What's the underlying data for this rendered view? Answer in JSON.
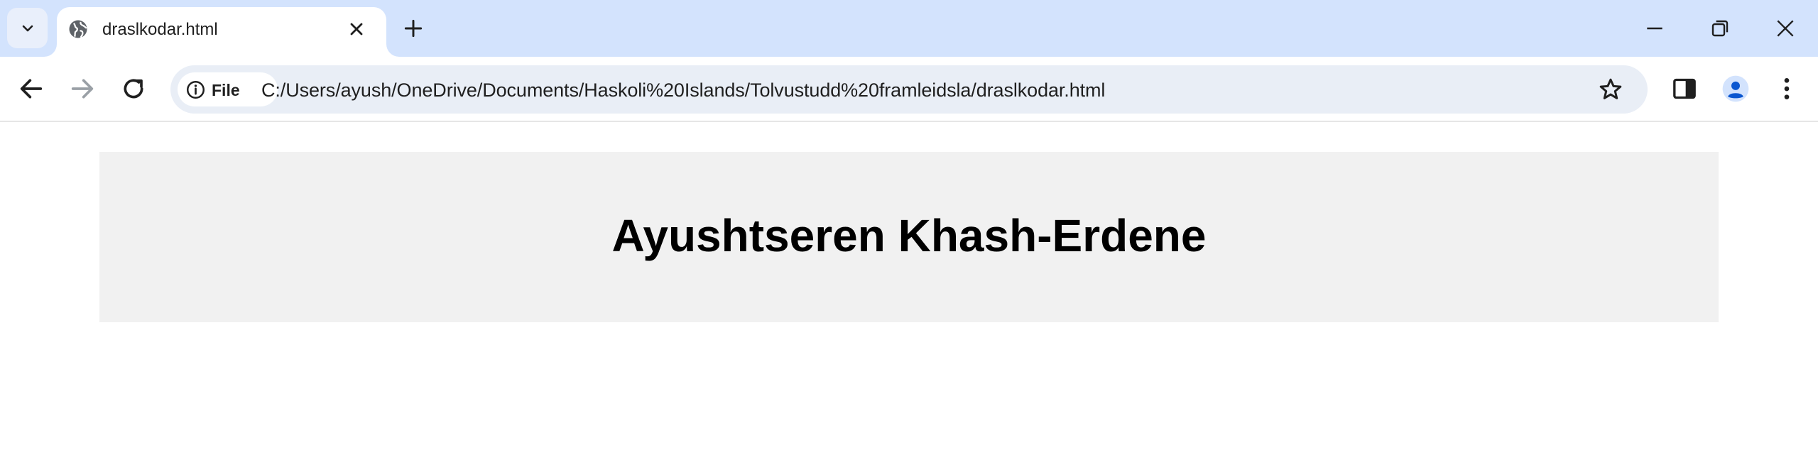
{
  "browser": {
    "tab": {
      "title": "draslkodar.html"
    },
    "address_bar": {
      "chip_label": "File",
      "url": "C:/Users/ayush/OneDrive/Documents/Haskoli%20Islands/Tolvustudd%20framleidsla/draslkodar.html"
    }
  },
  "page": {
    "heading": "Ayushtseren Khash-Erdene"
  },
  "colors": {
    "tabstrip": "#d3e3fd",
    "omnibox": "#e9eef6",
    "header_box": "#f1f1f1",
    "avatar": "#0b57d0"
  }
}
